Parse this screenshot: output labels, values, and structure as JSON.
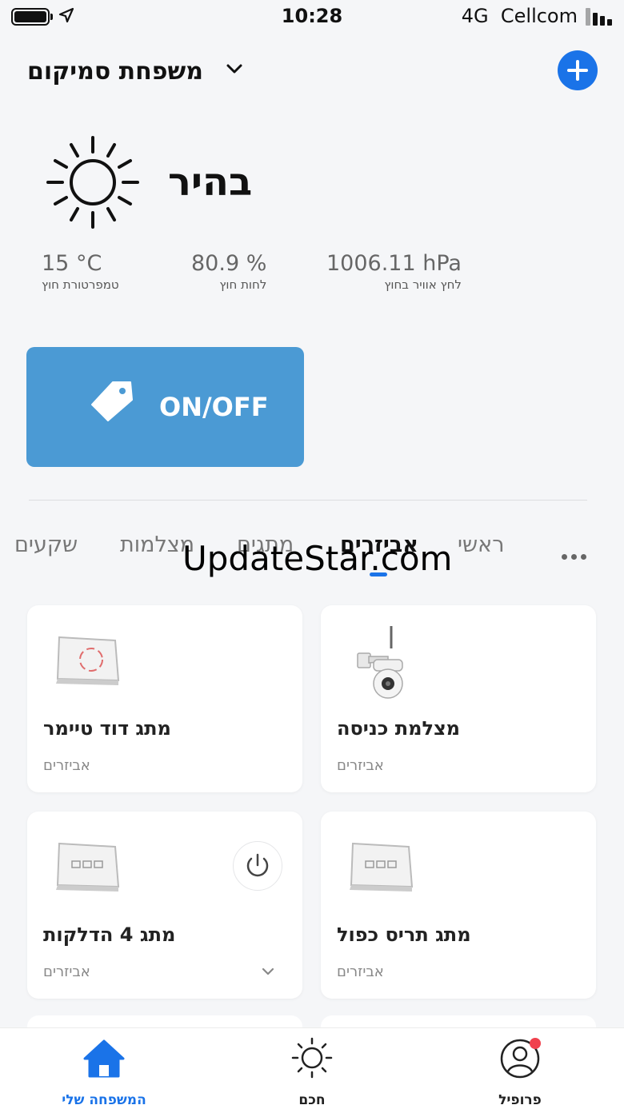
{
  "status_bar": {
    "time": "10:28",
    "network": "4G",
    "carrier": "Cellcom",
    "battery_level": 1.0
  },
  "header": {
    "home_name": "משפחת סמיקום",
    "add_icon": "plus-icon"
  },
  "weather": {
    "condition": "בהיר",
    "icon": "sun-icon",
    "stats": [
      {
        "value": "15 °C",
        "label": "טמפרטורת חוץ"
      },
      {
        "value": "80.9 %",
        "label": "לחות חוץ"
      },
      {
        "value": "1006.11 hPa",
        "label": "לחץ אוויר בחוץ"
      }
    ]
  },
  "scene": {
    "label": "ON/OFF",
    "icon": "tag-icon",
    "color": "#4b9ad4"
  },
  "tabs": {
    "items": [
      "שקעים",
      "מצלמות",
      "מתגים",
      "אביזרים",
      "ראשי"
    ],
    "active": "אביזרים",
    "more_icon": "more-dots-icon"
  },
  "watermark": "UpdateStar.com",
  "devices": [
    {
      "name": "מתג דוד טיימר",
      "room": "אביזרים",
      "icon": "touch-switch-icon"
    },
    {
      "name": "מצלמת כניסה",
      "room": "אביזרים",
      "icon": "security-camera-icon"
    },
    {
      "name": "מתג 4 הדלקות",
      "room": "אביזרים",
      "icon": "light-switch-icon"
    },
    {
      "name": "מתג תריס כפול",
      "room": "אביזרים",
      "icon": "light-switch-icon"
    }
  ],
  "bottom_nav": [
    {
      "label": "המשפחה שלי",
      "icon": "home-icon",
      "active": true
    },
    {
      "label": "חכם",
      "icon": "sun-icon",
      "active": false
    },
    {
      "label": "פרופיל",
      "icon": "profile-icon",
      "active": false
    }
  ],
  "colors": {
    "accent": "#1a73e8",
    "background": "#f5f6f8",
    "badge": "#f0414d"
  }
}
